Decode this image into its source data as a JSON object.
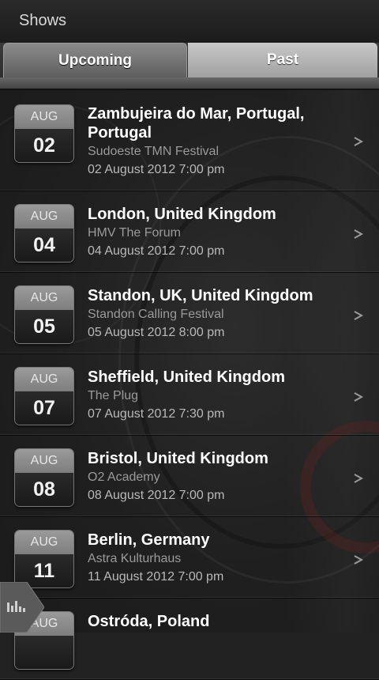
{
  "header": {
    "title": "Shows"
  },
  "tabs": [
    {
      "label": "Upcoming",
      "active": true
    },
    {
      "label": "Past",
      "active": false
    }
  ],
  "shows": [
    {
      "month": "AUG",
      "day": "02",
      "city": "Zambujeira do Mar, Portugal, Portugal",
      "venue": "Sudoeste TMN Festival",
      "datetime": "02 August 2012  7:00 pm"
    },
    {
      "month": "AUG",
      "day": "04",
      "city": "London, United Kingdom",
      "venue": "HMV The Forum",
      "datetime": "04 August 2012  7:00 pm"
    },
    {
      "month": "AUG",
      "day": "05",
      "city": "Standon, UK, United Kingdom",
      "venue": "Standon Calling Festival",
      "datetime": "05 August 2012  8:00 pm"
    },
    {
      "month": "AUG",
      "day": "07",
      "city": "Sheffield, United Kingdom",
      "venue": "The Plug",
      "datetime": "07 August 2012  7:30 pm"
    },
    {
      "month": "AUG",
      "day": "08",
      "city": "Bristol, United Kingdom",
      "venue": "O2 Academy",
      "datetime": "08 August 2012  7:00 pm"
    },
    {
      "month": "AUG",
      "day": "11",
      "city": "Berlin, Germany",
      "venue": "Astra Kulturhaus",
      "datetime": "11 August 2012  7:00 pm"
    },
    {
      "month": "AUG",
      "day": "",
      "city": "Ostróda, Poland",
      "venue": "",
      "datetime": ""
    }
  ],
  "icons": {
    "row_action": "chevron-right-icon",
    "player": "equalizer-icon"
  },
  "colors": {
    "title_text": "#d8d8d8",
    "city_text": "#ffffff",
    "venue_text": "#9a9a9a",
    "date_text": "#b9b9b9"
  }
}
